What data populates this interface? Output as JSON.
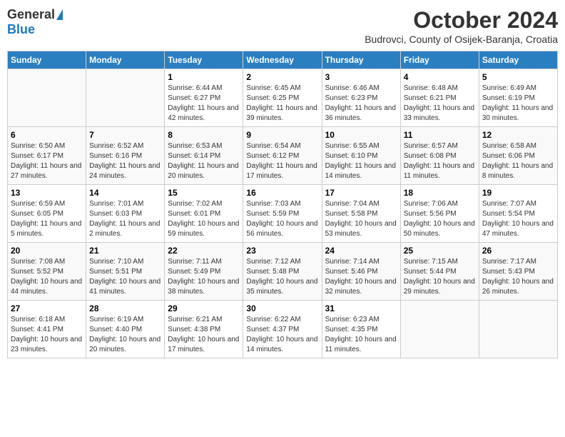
{
  "header": {
    "logo_general": "General",
    "logo_blue": "Blue",
    "month_title": "October 2024",
    "location": "Budrovci, County of Osijek-Baranja, Croatia"
  },
  "days_of_week": [
    "Sunday",
    "Monday",
    "Tuesday",
    "Wednesday",
    "Thursday",
    "Friday",
    "Saturday"
  ],
  "weeks": [
    [
      {
        "day": "",
        "sunrise": "",
        "sunset": "",
        "daylight": ""
      },
      {
        "day": "",
        "sunrise": "",
        "sunset": "",
        "daylight": ""
      },
      {
        "day": "1",
        "sunrise": "Sunrise: 6:44 AM",
        "sunset": "Sunset: 6:27 PM",
        "daylight": "Daylight: 11 hours and 42 minutes."
      },
      {
        "day": "2",
        "sunrise": "Sunrise: 6:45 AM",
        "sunset": "Sunset: 6:25 PM",
        "daylight": "Daylight: 11 hours and 39 minutes."
      },
      {
        "day": "3",
        "sunrise": "Sunrise: 6:46 AM",
        "sunset": "Sunset: 6:23 PM",
        "daylight": "Daylight: 11 hours and 36 minutes."
      },
      {
        "day": "4",
        "sunrise": "Sunrise: 6:48 AM",
        "sunset": "Sunset: 6:21 PM",
        "daylight": "Daylight: 11 hours and 33 minutes."
      },
      {
        "day": "5",
        "sunrise": "Sunrise: 6:49 AM",
        "sunset": "Sunset: 6:19 PM",
        "daylight": "Daylight: 11 hours and 30 minutes."
      }
    ],
    [
      {
        "day": "6",
        "sunrise": "Sunrise: 6:50 AM",
        "sunset": "Sunset: 6:17 PM",
        "daylight": "Daylight: 11 hours and 27 minutes."
      },
      {
        "day": "7",
        "sunrise": "Sunrise: 6:52 AM",
        "sunset": "Sunset: 6:16 PM",
        "daylight": "Daylight: 11 hours and 24 minutes."
      },
      {
        "day": "8",
        "sunrise": "Sunrise: 6:53 AM",
        "sunset": "Sunset: 6:14 PM",
        "daylight": "Daylight: 11 hours and 20 minutes."
      },
      {
        "day": "9",
        "sunrise": "Sunrise: 6:54 AM",
        "sunset": "Sunset: 6:12 PM",
        "daylight": "Daylight: 11 hours and 17 minutes."
      },
      {
        "day": "10",
        "sunrise": "Sunrise: 6:55 AM",
        "sunset": "Sunset: 6:10 PM",
        "daylight": "Daylight: 11 hours and 14 minutes."
      },
      {
        "day": "11",
        "sunrise": "Sunrise: 6:57 AM",
        "sunset": "Sunset: 6:08 PM",
        "daylight": "Daylight: 11 hours and 11 minutes."
      },
      {
        "day": "12",
        "sunrise": "Sunrise: 6:58 AM",
        "sunset": "Sunset: 6:06 PM",
        "daylight": "Daylight: 11 hours and 8 minutes."
      }
    ],
    [
      {
        "day": "13",
        "sunrise": "Sunrise: 6:59 AM",
        "sunset": "Sunset: 6:05 PM",
        "daylight": "Daylight: 11 hours and 5 minutes."
      },
      {
        "day": "14",
        "sunrise": "Sunrise: 7:01 AM",
        "sunset": "Sunset: 6:03 PM",
        "daylight": "Daylight: 11 hours and 2 minutes."
      },
      {
        "day": "15",
        "sunrise": "Sunrise: 7:02 AM",
        "sunset": "Sunset: 6:01 PM",
        "daylight": "Daylight: 10 hours and 59 minutes."
      },
      {
        "day": "16",
        "sunrise": "Sunrise: 7:03 AM",
        "sunset": "Sunset: 5:59 PM",
        "daylight": "Daylight: 10 hours and 56 minutes."
      },
      {
        "day": "17",
        "sunrise": "Sunrise: 7:04 AM",
        "sunset": "Sunset: 5:58 PM",
        "daylight": "Daylight: 10 hours and 53 minutes."
      },
      {
        "day": "18",
        "sunrise": "Sunrise: 7:06 AM",
        "sunset": "Sunset: 5:56 PM",
        "daylight": "Daylight: 10 hours and 50 minutes."
      },
      {
        "day": "19",
        "sunrise": "Sunrise: 7:07 AM",
        "sunset": "Sunset: 5:54 PM",
        "daylight": "Daylight: 10 hours and 47 minutes."
      }
    ],
    [
      {
        "day": "20",
        "sunrise": "Sunrise: 7:08 AM",
        "sunset": "Sunset: 5:52 PM",
        "daylight": "Daylight: 10 hours and 44 minutes."
      },
      {
        "day": "21",
        "sunrise": "Sunrise: 7:10 AM",
        "sunset": "Sunset: 5:51 PM",
        "daylight": "Daylight: 10 hours and 41 minutes."
      },
      {
        "day": "22",
        "sunrise": "Sunrise: 7:11 AM",
        "sunset": "Sunset: 5:49 PM",
        "daylight": "Daylight: 10 hours and 38 minutes."
      },
      {
        "day": "23",
        "sunrise": "Sunrise: 7:12 AM",
        "sunset": "Sunset: 5:48 PM",
        "daylight": "Daylight: 10 hours and 35 minutes."
      },
      {
        "day": "24",
        "sunrise": "Sunrise: 7:14 AM",
        "sunset": "Sunset: 5:46 PM",
        "daylight": "Daylight: 10 hours and 32 minutes."
      },
      {
        "day": "25",
        "sunrise": "Sunrise: 7:15 AM",
        "sunset": "Sunset: 5:44 PM",
        "daylight": "Daylight: 10 hours and 29 minutes."
      },
      {
        "day": "26",
        "sunrise": "Sunrise: 7:17 AM",
        "sunset": "Sunset: 5:43 PM",
        "daylight": "Daylight: 10 hours and 26 minutes."
      }
    ],
    [
      {
        "day": "27",
        "sunrise": "Sunrise: 6:18 AM",
        "sunset": "Sunset: 4:41 PM",
        "daylight": "Daylight: 10 hours and 23 minutes."
      },
      {
        "day": "28",
        "sunrise": "Sunrise: 6:19 AM",
        "sunset": "Sunset: 4:40 PM",
        "daylight": "Daylight: 10 hours and 20 minutes."
      },
      {
        "day": "29",
        "sunrise": "Sunrise: 6:21 AM",
        "sunset": "Sunset: 4:38 PM",
        "daylight": "Daylight: 10 hours and 17 minutes."
      },
      {
        "day": "30",
        "sunrise": "Sunrise: 6:22 AM",
        "sunset": "Sunset: 4:37 PM",
        "daylight": "Daylight: 10 hours and 14 minutes."
      },
      {
        "day": "31",
        "sunrise": "Sunrise: 6:23 AM",
        "sunset": "Sunset: 4:35 PM",
        "daylight": "Daylight: 10 hours and 11 minutes."
      },
      {
        "day": "",
        "sunrise": "",
        "sunset": "",
        "daylight": ""
      },
      {
        "day": "",
        "sunrise": "",
        "sunset": "",
        "daylight": ""
      }
    ]
  ]
}
